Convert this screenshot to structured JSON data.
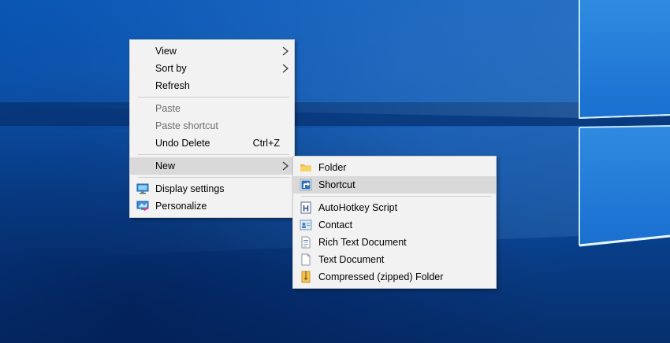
{
  "context_menu": {
    "items": [
      {
        "label": "View"
      },
      {
        "label": "Sort by"
      },
      {
        "label": "Refresh"
      },
      {
        "label": "Paste"
      },
      {
        "label": "Paste shortcut"
      },
      {
        "label": "Undo Delete",
        "shortcut": "Ctrl+Z"
      },
      {
        "label": "New"
      },
      {
        "label": "Display settings",
        "icon": "display-settings-icon"
      },
      {
        "label": "Personalize",
        "icon": "personalize-icon"
      }
    ]
  },
  "new_submenu": {
    "items": [
      {
        "label": "Folder",
        "icon": "folder-icon"
      },
      {
        "label": "Shortcut",
        "icon": "shortcut-icon"
      },
      {
        "label": "AutoHotkey Script",
        "icon": "autohotkey-icon"
      },
      {
        "label": "Contact",
        "icon": "contact-icon"
      },
      {
        "label": "Rich Text Document",
        "icon": "rich-text-document-icon"
      },
      {
        "label": "Text Document",
        "icon": "text-document-icon"
      },
      {
        "label": "Compressed (zipped) Folder",
        "icon": "zip-folder-icon"
      }
    ]
  },
  "colors": {
    "menu_background": "#f2f2f2",
    "menu_highlight": "#d9d9d9",
    "disabled_text": "#6d6d6d",
    "desktop_blue": "#0b4fa6"
  }
}
